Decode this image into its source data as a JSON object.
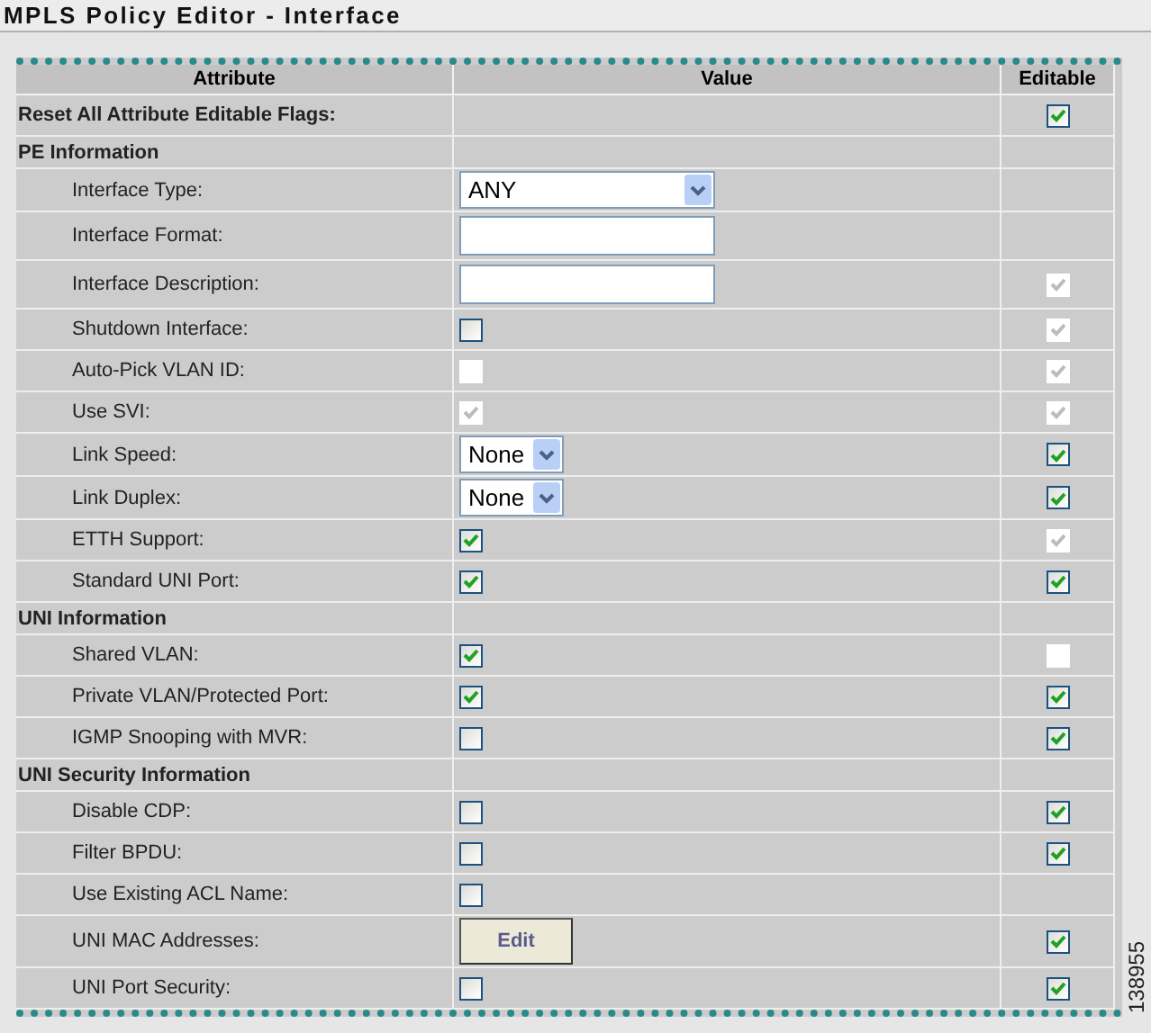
{
  "window": {
    "title": "MPLS Policy Editor - Interface"
  },
  "table": {
    "columns": [
      "Attribute",
      "Value",
      "Editable"
    ],
    "rows": [
      {
        "kind": "reset",
        "label": "Reset All Attribute Editable Flags:",
        "editable": {
          "checked": true,
          "disabled": false
        }
      },
      {
        "kind": "section",
        "label": "PE Information"
      },
      {
        "kind": "attribute",
        "label": "Interface Type:",
        "value": {
          "kind": "select",
          "text": "ANY",
          "wide": true
        }
      },
      {
        "kind": "attribute",
        "label": "Interface Format:",
        "value": {
          "kind": "text"
        }
      },
      {
        "kind": "attribute",
        "label": "Interface Description:",
        "value": {
          "kind": "text"
        },
        "editable": {
          "checked": true,
          "disabled": true
        }
      },
      {
        "kind": "attribute",
        "label": "Shutdown Interface:",
        "value": {
          "kind": "checkbox",
          "checked": false,
          "disabled": false
        },
        "editable": {
          "checked": true,
          "disabled": true
        }
      },
      {
        "kind": "attribute",
        "label": "Auto-Pick VLAN ID:",
        "value": {
          "kind": "checkbox",
          "checked": false,
          "disabled": true
        },
        "editable": {
          "checked": true,
          "disabled": true
        }
      },
      {
        "kind": "attribute",
        "label": "Use SVI:",
        "value": {
          "kind": "checkbox",
          "checked": true,
          "disabled": true
        },
        "editable": {
          "checked": true,
          "disabled": true
        }
      },
      {
        "kind": "attribute",
        "label": "Link Speed:",
        "value": {
          "kind": "select",
          "text": "None",
          "wide": false
        },
        "editable": {
          "checked": true,
          "disabled": false
        }
      },
      {
        "kind": "attribute",
        "label": "Link Duplex:",
        "value": {
          "kind": "select",
          "text": "None",
          "wide": false
        },
        "editable": {
          "checked": true,
          "disabled": false
        }
      },
      {
        "kind": "attribute",
        "label": "ETTH Support:",
        "value": {
          "kind": "checkbox",
          "checked": true,
          "disabled": false
        },
        "editable": {
          "checked": true,
          "disabled": true
        }
      },
      {
        "kind": "attribute",
        "label": "Standard UNI Port:",
        "value": {
          "kind": "checkbox",
          "checked": true,
          "disabled": false
        },
        "editable": {
          "checked": true,
          "disabled": false
        }
      },
      {
        "kind": "section",
        "label": "UNI Information"
      },
      {
        "kind": "attribute",
        "label": "Shared VLAN:",
        "value": {
          "kind": "checkbox",
          "checked": true,
          "disabled": false
        },
        "editable": {
          "checked": false,
          "disabled": true
        }
      },
      {
        "kind": "attribute",
        "label": "Private VLAN/Protected Port:",
        "value": {
          "kind": "checkbox",
          "checked": true,
          "disabled": false
        },
        "editable": {
          "checked": true,
          "disabled": false
        }
      },
      {
        "kind": "attribute",
        "label": "IGMP Snooping with MVR:",
        "value": {
          "kind": "checkbox",
          "checked": false,
          "disabled": false
        },
        "editable": {
          "checked": true,
          "disabled": false
        }
      },
      {
        "kind": "section",
        "label": "UNI Security Information"
      },
      {
        "kind": "attribute",
        "label": "Disable CDP:",
        "value": {
          "kind": "checkbox",
          "checked": false,
          "disabled": false
        },
        "editable": {
          "checked": true,
          "disabled": false
        }
      },
      {
        "kind": "attribute",
        "label": "Filter BPDU:",
        "value": {
          "kind": "checkbox",
          "checked": false,
          "disabled": false
        },
        "editable": {
          "checked": true,
          "disabled": false
        }
      },
      {
        "kind": "attribute",
        "label": "Use Existing ACL Name:",
        "value": {
          "kind": "checkbox",
          "checked": false,
          "disabled": false
        }
      },
      {
        "kind": "attribute",
        "label": "UNI MAC Addresses:",
        "value": {
          "kind": "button",
          "text": "Edit"
        },
        "editable": {
          "checked": true,
          "disabled": false
        }
      },
      {
        "kind": "attribute",
        "label": "UNI Port Security:",
        "value": {
          "kind": "checkbox",
          "checked": false,
          "disabled": false
        },
        "editable": {
          "checked": true,
          "disabled": false
        }
      }
    ]
  },
  "figure_id": "138955"
}
